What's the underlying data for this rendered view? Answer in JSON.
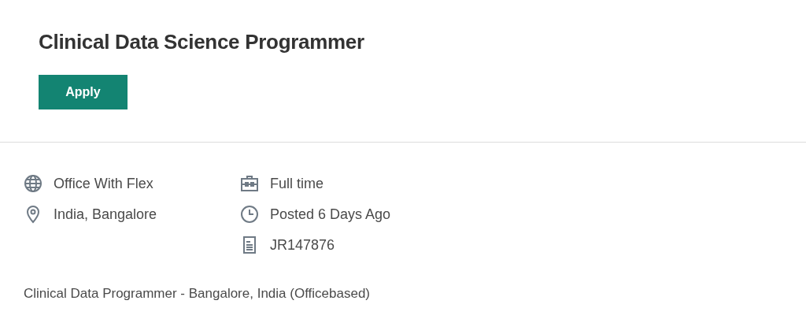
{
  "job": {
    "title": "Clinical Data Science Programmer",
    "apply_button": "Apply"
  },
  "details": [
    [
      {
        "kind": "globe",
        "text": "Office With Flex"
      },
      {
        "kind": "pin",
        "text": "India, Bangalore"
      }
    ],
    [
      {
        "kind": "briefcase",
        "text": "Full time"
      },
      {
        "kind": "clock",
        "text": "Posted 6 Days Ago"
      },
      {
        "kind": "document",
        "text": "JR147876"
      }
    ]
  ],
  "description": "Clinical Data Programmer - Bangalore, India (Officebased)"
}
